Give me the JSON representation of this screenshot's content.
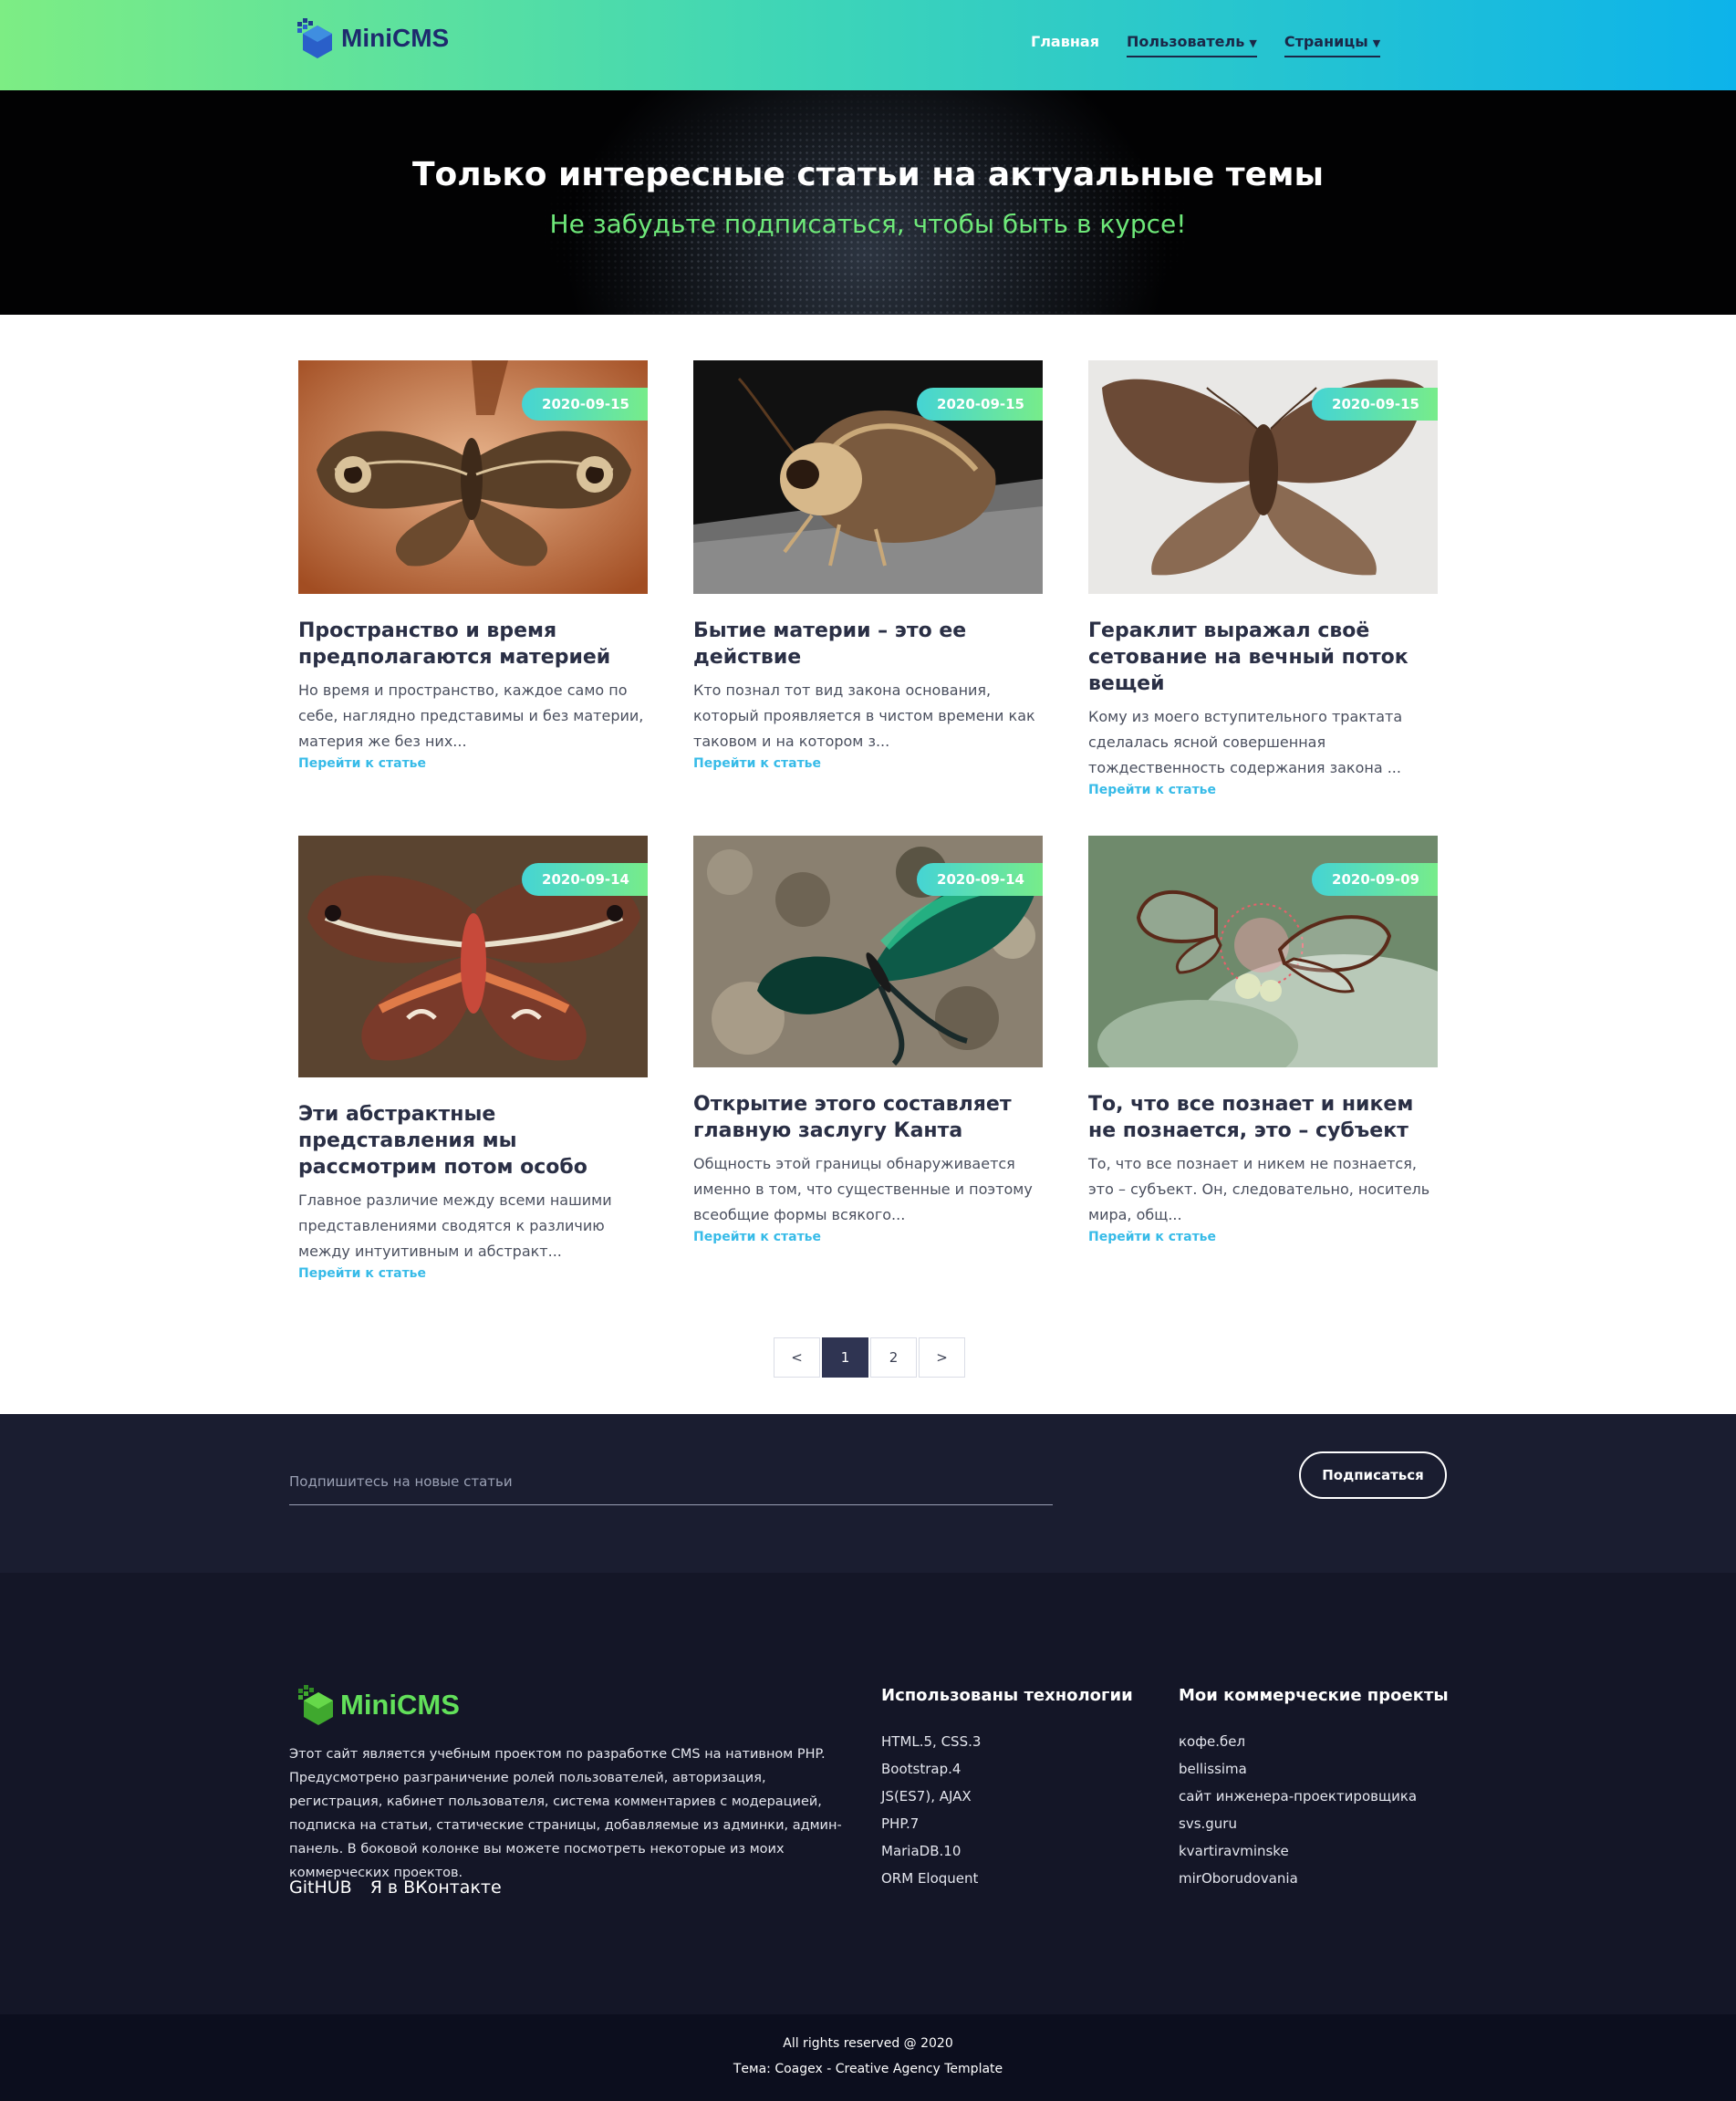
{
  "brand": {
    "name": "MiniCMS"
  },
  "nav": {
    "items": [
      {
        "label": "Главная"
      },
      {
        "label": "Пользователь"
      },
      {
        "label": "Страницы"
      }
    ]
  },
  "hero": {
    "title": "Только интересные статьи на актуальные темы",
    "subtitle": "Не забудьте подписаться, чтобы быть в курсе!"
  },
  "articles": [
    {
      "date": "2020-09-15",
      "title": "Пространство и время предполагаются материей",
      "excerpt": "Но время и пространство, каждое само по себе, наглядно представимы и без материи, материя же без них...",
      "link": "Перейти к статье",
      "image": "owl-moth-photo"
    },
    {
      "date": "2020-09-15",
      "title": "Бытие материи – это ее действие",
      "excerpt": "Кто познал тот вид закона основания, который проявляется в чистом времени как таковом и на котором з...",
      "link": "Перейти к статье",
      "image": "fluffy-moth-photo"
    },
    {
      "date": "2020-09-15",
      "title": "Гераклит выражал своё сетование на вечный поток вещей",
      "excerpt": "Кому из моего вступительного трактата сделалась ясной совершенная тождественность содержания закона ...",
      "link": "Перейти к статье",
      "image": "brown-moth-photo"
    },
    {
      "date": "2020-09-14",
      "title": "Эти абстрактные представления мы рассмотрим потом особо",
      "excerpt": "Главное различие между всеми нашими представлениями сводятся к различию между интуитивным и абстракт...",
      "link": "Перейти к статье",
      "image": "cecropia-moth-photo"
    },
    {
      "date": "2020-09-14",
      "title": "Открытие этого составляет главную заслугу Канта",
      "excerpt": "Общность этой границы обнаруживается именно в том, что существенные и поэтому всеобщие формы всякого...",
      "link": "Перейти к статье",
      "image": "swallowtail-butterfly-photo"
    },
    {
      "date": "2020-09-09",
      "title": "То, что все познает и никем не познается, это – субъект",
      "excerpt": "То, что все познает и никем не познается, это – субъект. Он, следовательно, носитель мира, общ...",
      "link": "Перейти к статье",
      "image": "glasswing-butterfly-photo"
    }
  ],
  "pagination": {
    "prev": "<",
    "pages": [
      "1",
      "2"
    ],
    "current": "1",
    "next": ">"
  },
  "subscribe": {
    "placeholder": "Подпишитесь на новые статьи",
    "button": "Подписаться"
  },
  "footer": {
    "brand": "MiniCMS",
    "about": "Этот сайт является учебным проектом по разработке CMS на нативном PHP. Предусмотрено разграничение ролей пользователей, авторизация, регистрация, кабинет пользователя, система комментариев с модерацией, подписка на статьи, статические страницы, добавляемые из админки, админ-панель. В боковой колонке вы можете посмотреть некоторые из моих коммерческих проектов.",
    "social": [
      "GitHUB",
      "Я в ВКонтакте"
    ],
    "tech_title": "Использованы технологии",
    "tech": [
      "HTML.5, CSS.3",
      "Bootstrap.4",
      "JS(ES7), AJAX",
      "PHP.7",
      "MariaDB.10",
      "ORM Eloquent"
    ],
    "projects_title": "Мои коммерческие проекты",
    "projects": [
      "кофе.бел",
      "bellissima",
      "сайт инженера-проектировщика",
      "svs.guru",
      "kvartiravminske",
      "mirOborudovania"
    ]
  },
  "copyright": {
    "line1": "All rights reserved @ 2020",
    "line2": "Тема: Coagex - Creative Agency Template"
  },
  "colors": {
    "accent": "#37bbe8",
    "green": "#6ee879",
    "dark": "#1a1d30"
  }
}
